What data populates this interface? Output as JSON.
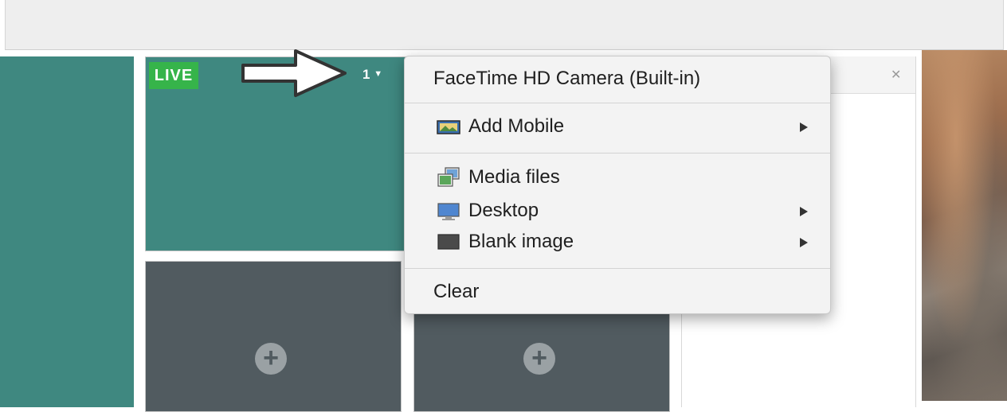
{
  "tile": {
    "live_label": "LIVE",
    "source_number": "1"
  },
  "context_menu": {
    "items": [
      {
        "label": "FaceTime HD Camera (Built-in)",
        "icon": "",
        "submenu": false
      },
      {
        "label": "Add Mobile",
        "icon": "mobile-image-icon",
        "submenu": true
      },
      {
        "label": "Media files",
        "icon": "media-files-icon",
        "submenu": false
      },
      {
        "label": "Desktop",
        "icon": "desktop-monitor-icon",
        "submenu": true
      },
      {
        "label": "Blank image",
        "icon": "blank-image-icon",
        "submenu": true
      },
      {
        "label": "Clear",
        "icon": "",
        "submenu": false
      }
    ]
  },
  "icons": {
    "add": "plus-circle-icon",
    "close": "close-icon",
    "pointer": "pointer-arrow-icon",
    "dropdown": "chevron-down-icon",
    "submenu": "chevron-right-icon"
  },
  "colors": {
    "live_green": "#36b44a",
    "tile_teal": "#3f8880",
    "tile_empty": "#515b60",
    "menu_bg": "#f3f3f3"
  }
}
